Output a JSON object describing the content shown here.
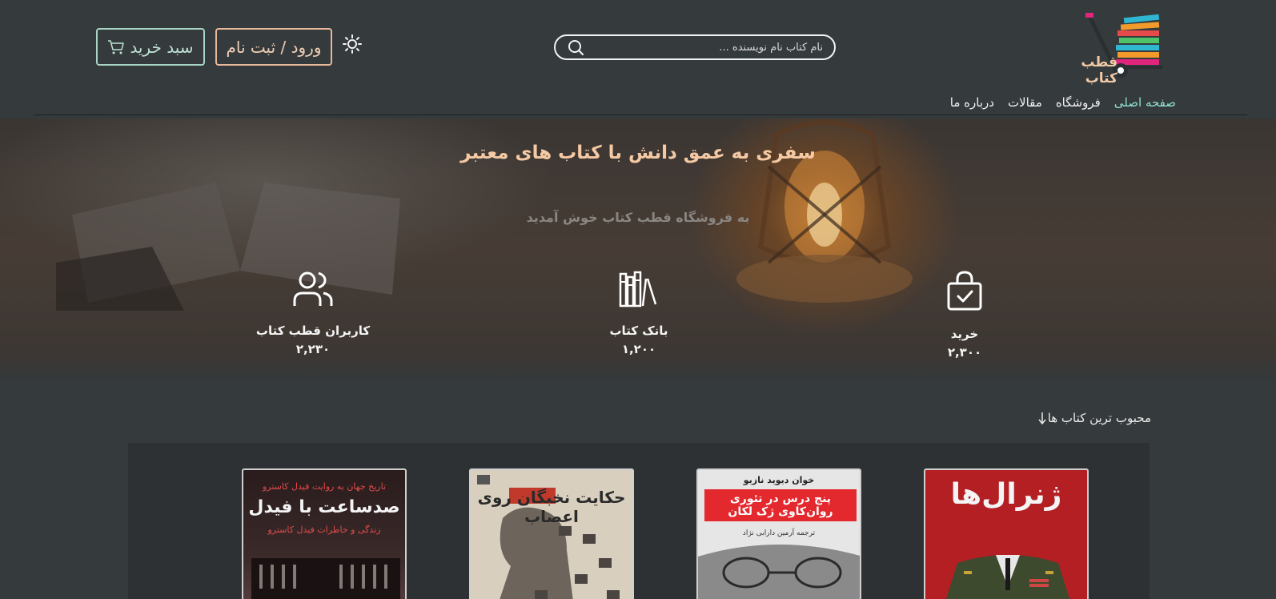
{
  "header": {
    "logo_text": "قطب کتاب",
    "search_placeholder": "نام کتاب نام نویسنده ...",
    "login_label": "ورود / ثبت نام",
    "cart_label": "سبد خرید"
  },
  "nav": {
    "items": [
      {
        "label": "صفحه اصلی",
        "active": true
      },
      {
        "label": "فروشگاه",
        "active": false
      },
      {
        "label": "مقالات",
        "active": false
      },
      {
        "label": "درباره ما",
        "active": false
      }
    ]
  },
  "hero": {
    "title": "سفری به عمق دانش با کتاب های معتبر",
    "subtitle": "به فروشگاه قطب کتاب خوش آمدید"
  },
  "stats": [
    {
      "icon": "users-icon",
      "label": "کاربران قطب کتاب",
      "value": "۲,۲۳۰"
    },
    {
      "icon": "bookshelf-icon",
      "label": "بانک کتاب",
      "value": "۱,۲۰۰"
    },
    {
      "icon": "shopping-bag-check-icon",
      "label": "خرید",
      "value": "۲,۳۰۰"
    }
  ],
  "popular": {
    "title": "محبوب ترین کتاب ها",
    "books": [
      {
        "top": "تاریخ جهان به روایت فیدل کاسترو",
        "title": "صدساعت با فیدل",
        "sub": "زندگی و خاطرات فیدل کاسترو"
      },
      {
        "title": "حکایت نخبگان روی اعصاب"
      },
      {
        "author": "خوان دیوید نازیو",
        "title": "پنج درس در تئوری روان‌کاوی ژک لکان",
        "translator": "ترجمه آرمین دارابی نژاد"
      },
      {
        "title": "ژنرال‌ها"
      }
    ]
  },
  "colors": {
    "background": "#353a3c",
    "accent_peach": "#f4c9a3",
    "accent_teal": "#8fe0d0",
    "login_border": "#e7b899",
    "cart_border": "#a8d4c4"
  }
}
